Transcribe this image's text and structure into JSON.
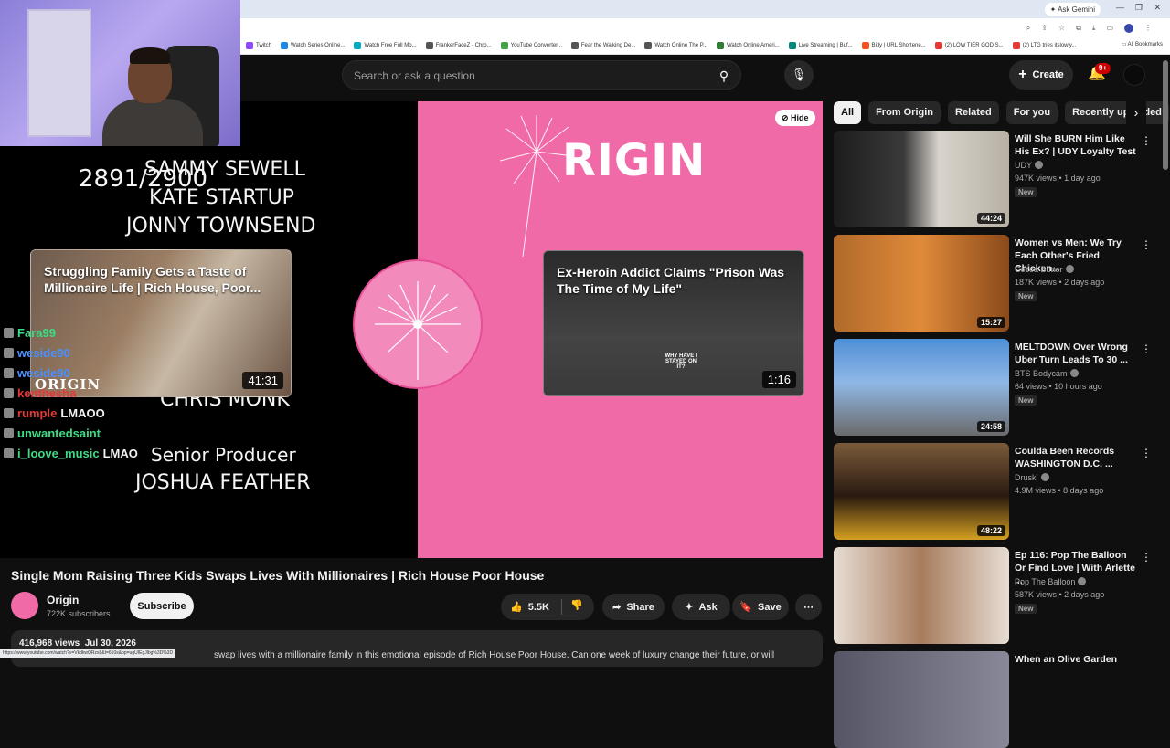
{
  "browser": {
    "ask_gemini": "Ask Gemini",
    "all_bookmarks": "All Bookmarks",
    "bookmarks": [
      {
        "label": "Twitch",
        "color": "#9146ff"
      },
      {
        "label": "Watch Series Online...",
        "color": "#1e88e5"
      },
      {
        "label": "Watch Free Full Mo...",
        "color": "#00acc1"
      },
      {
        "label": "FrankerFaceZ - Chro...",
        "color": "#555555"
      },
      {
        "label": "YouTube Converter...",
        "color": "#43a047"
      },
      {
        "label": "Fear the Walking De...",
        "color": "#555555"
      },
      {
        "label": "Watch Online The P...",
        "color": "#555555"
      },
      {
        "label": "Watch Online Ameri...",
        "color": "#2e7d32"
      },
      {
        "label": "Live Streaming | Buf...",
        "color": "#00897b"
      },
      {
        "label": "Bitly | URL Shortene...",
        "color": "#f4511e"
      },
      {
        "label": "(2) LOW TIER GOD S...",
        "color": "#e53935"
      },
      {
        "label": "(2) LTG tries itslowly...",
        "color": "#e53935"
      }
    ],
    "status_url": "https://www.youtube.com/watch?v=VkdkwQRzs8&t=610s&pp=ugUIEgJlbg%3D%3D"
  },
  "header": {
    "search_placeholder": "Search or ask a question",
    "create_label": "Create",
    "notification_count": "9+"
  },
  "player": {
    "hide_label": "Hide",
    "origin_logo": "RIGIN",
    "credits": {
      "count": "2891/2900",
      "line1": "SAMMY SEWELL",
      "line2": "KATE STARTUP",
      "line3": "JONNY TOWNSEND",
      "line4": "CHRIS MONK",
      "role": "Senior Producer",
      "line5": "JOSHUA FEATHER"
    },
    "endcard_left": {
      "title": "Struggling Family Gets a Taste of Millionaire Life | Rich House, Poor...",
      "duration": "41:31",
      "brand": "ORIGIN"
    },
    "endcard_right": {
      "title": "Ex-Heroin Addict Claims \"Prison Was The Time of My Life\"",
      "duration": "1:16",
      "caption": "WHY HAVE I STAYED ON IT?"
    },
    "chat": [
      {
        "user": "Fara99",
        "msg": "",
        "color": "#3ddc84"
      },
      {
        "user": "weside90",
        "msg": "",
        "color": "#4a90ff"
      },
      {
        "user": "weside90",
        "msg": "",
        "color": "#4a90ff"
      },
      {
        "user": "kenthesha",
        "msg": "",
        "color": "#e53935"
      },
      {
        "user": "rumple",
        "msg": "LMAOO",
        "color": "#e53935"
      },
      {
        "user": "unwantedsaint",
        "msg": "",
        "color": "#3ddc84"
      },
      {
        "user": "i_loove_music",
        "msg": "LMAO",
        "color": "#3ddc84"
      }
    ]
  },
  "video": {
    "title": "Single Mom Raising Three Kids Swaps Lives With Millionaires | Rich House Poor House",
    "channel": "Origin",
    "subscribers": "722K subscribers",
    "subscribe_label": "Subscribe",
    "likes": "5.5K",
    "share_label": "Share",
    "ask_label": "Ask",
    "save_label": "Save",
    "views": "416,968 views",
    "date": "Jul 30, 2026",
    "description": "swap lives with a millionaire family in this emotional episode of Rich House Poor House. Can one week of luxury change their future, or will"
  },
  "chips": [
    "All",
    "From Origin",
    "Related",
    "For you",
    "Recently uploaded"
  ],
  "recommendations": [
    {
      "title": "Will She BURN Him Like His Ex? | UDY Loyalty Test",
      "channel": "UDY",
      "meta": "947K views • 1 day ago",
      "badge": "New",
      "duration": "44:24"
    },
    {
      "title": "Women vs Men: We Try Each Other's Fried Chicken...",
      "channel": "Cocoa Butter",
      "meta": "187K views • 2 days ago",
      "badge": "New",
      "duration": "15:27"
    },
    {
      "title": "MELTDOWN Over Wrong Uber Turn Leads To 30 ...",
      "channel": "BTS Bodycam",
      "meta": "64 views • 10 hours ago",
      "badge": "New",
      "duration": "24:58"
    },
    {
      "title": "Coulda Been Records WASHINGTON D.C. ...",
      "channel": "Druski",
      "meta": "4.9M views • 8 days ago",
      "badge": "",
      "duration": "48:22"
    },
    {
      "title": "Ep 116: Pop The Balloon Or Find Love | With Arlette ...",
      "channel": "Pop The Balloon",
      "meta": "587K views • 2 days ago",
      "badge": "New",
      "duration": ""
    },
    {
      "title": "When an Olive Garden",
      "channel": "",
      "meta": "",
      "badge": "",
      "duration": ""
    }
  ]
}
